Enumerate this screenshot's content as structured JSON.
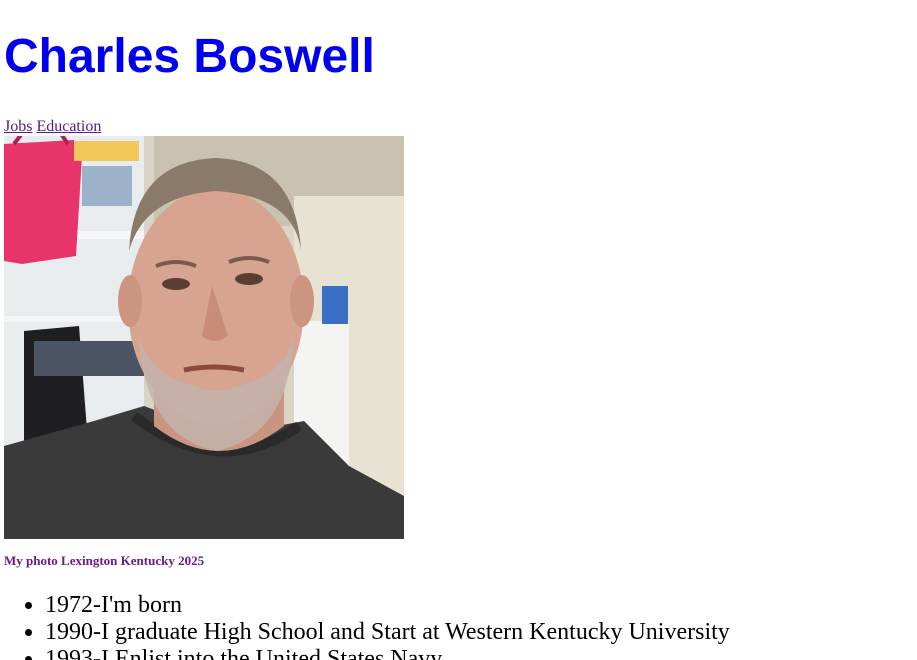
{
  "header": {
    "title": "Charles Boswell"
  },
  "nav": {
    "links": [
      {
        "label": "Jobs"
      },
      {
        "label": "Education"
      }
    ]
  },
  "photo": {
    "alt": "Charles Boswell selfie",
    "caption": "My photo Lexington Kentucky 2025"
  },
  "timeline": {
    "items": [
      {
        "text": "1972-I'm born"
      },
      {
        "text": "1990-I graduate High School and Start at Western Kentucky University"
      },
      {
        "text": "1993-I Enlist into the United States Navy"
      }
    ]
  },
  "colors": {
    "title": "#0000ee",
    "visited_link": "#551a8b",
    "caption": "#6a1a8a"
  }
}
